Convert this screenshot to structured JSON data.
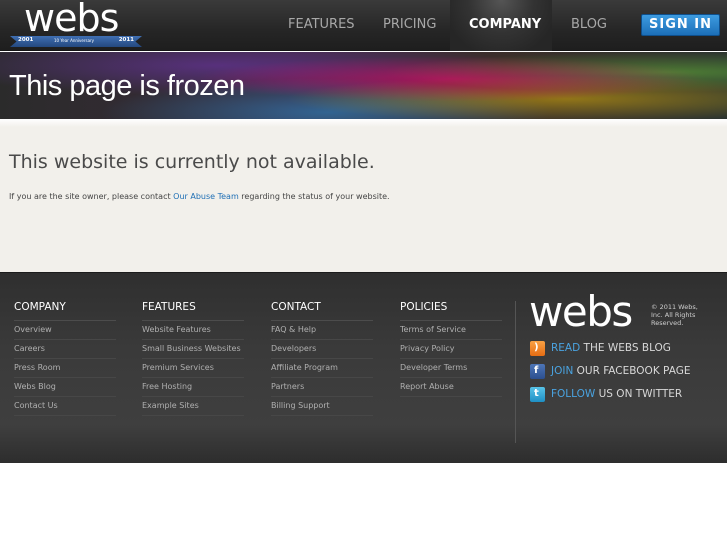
{
  "header": {
    "logo_text": "webs",
    "ribbon": {
      "left": "2001",
      "middle": "10 Year Anniversary",
      "right": "2011"
    },
    "nav": [
      {
        "label": "FEATURES",
        "active": false
      },
      {
        "label": "PRICING",
        "active": false
      },
      {
        "label": "COMPANY",
        "active": true
      },
      {
        "label": "BLOG",
        "active": false
      }
    ],
    "signin_label": "SIGN IN"
  },
  "banner": {
    "title": "This page is frozen"
  },
  "main": {
    "heading": "This website is currently not available.",
    "message_before": "If you are the site owner, please contact ",
    "message_link": "Our Abuse Team",
    "message_after": " regarding the status of your website."
  },
  "footer": {
    "columns": [
      {
        "heading": "COMPANY",
        "items": [
          "Overview",
          "Careers",
          "Press Room",
          "Webs Blog",
          "Contact Us"
        ]
      },
      {
        "heading": "FEATURES",
        "items": [
          "Website Features",
          "Small Business Websites",
          "Premium Services",
          "Free Hosting",
          "Example Sites"
        ]
      },
      {
        "heading": "CONTACT",
        "items": [
          "FAQ & Help",
          "Developers",
          "Affiliate Program",
          "Partners",
          "Billing Support"
        ]
      },
      {
        "heading": "POLICIES",
        "items": [
          "Terms of Service",
          "Privacy Policy",
          "Developer Terms",
          "Report Abuse"
        ]
      }
    ],
    "logo_text": "webs",
    "copyright": "© 2011 Webs, Inc. All Rights Reserved.",
    "social": [
      {
        "icon": "rss-icon",
        "verb": "READ",
        "rest": " THE WEBS BLOG"
      },
      {
        "icon": "facebook-icon",
        "verb": "JOIN",
        "rest": " OUR FACEBOOK PAGE"
      },
      {
        "icon": "twitter-icon",
        "verb": "FOLLOW",
        "rest": " US ON TWITTER"
      }
    ]
  },
  "colors": {
    "accent_blue": "#1f6fb5",
    "signin_blue": "#2a86d0",
    "header_bg": "#262626",
    "content_bg": "#f2f0eb",
    "footer_bg": "#3a3a3a"
  }
}
